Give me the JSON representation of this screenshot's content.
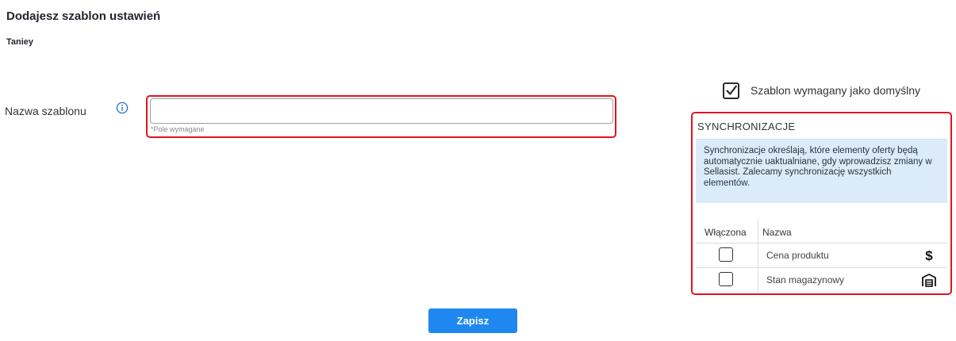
{
  "header": {
    "title": "Dodajesz szablon ustawień",
    "subtitle": "Taniey"
  },
  "form": {
    "name_label": "Nazwa szablonu",
    "name_value": "",
    "name_placeholder": "",
    "required_note": "*Pole wymagane",
    "info_icon": "info-circle-icon"
  },
  "default_option": {
    "label": "Szablon wymagany jako domyślny",
    "checked": true
  },
  "sync": {
    "title": "SYNCHRONIZACJE",
    "info": "Synchronizacje określają, które elementy oferty będą automatycznie uaktualniane, gdy wprowadzisz zmiany w Sellasist. Zalecamy synchronizację wszystkich elementów.",
    "columns": {
      "enabled": "Włączona",
      "name": "Nazwa"
    },
    "rows": [
      {
        "name": "Cena produktu",
        "enabled": false,
        "icon": "dollar-icon"
      },
      {
        "name": "Stan magazynowy",
        "enabled": false,
        "icon": "warehouse-icon"
      }
    ]
  },
  "actions": {
    "save_label": "Zapisz"
  },
  "colors": {
    "highlight": "#e0141e",
    "info_bg": "#dcebf9",
    "primary": "#1e88f0"
  }
}
